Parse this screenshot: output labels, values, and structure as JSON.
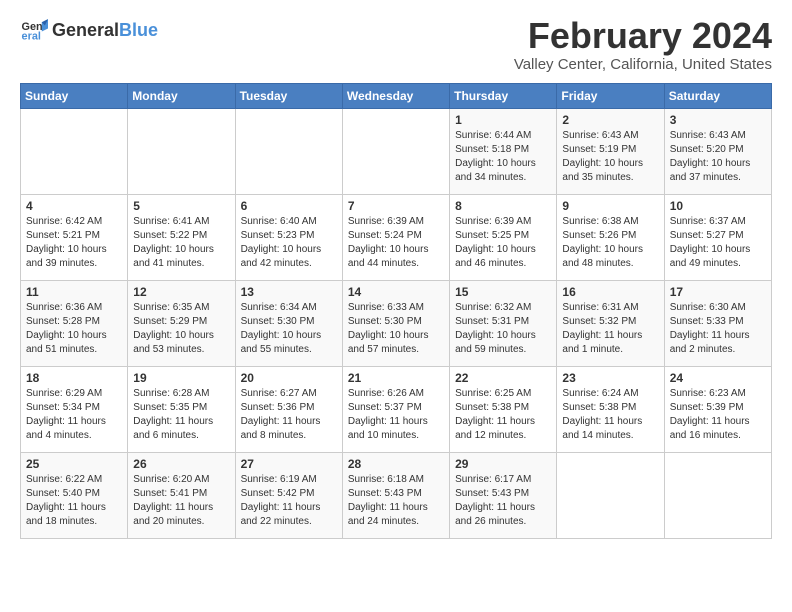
{
  "header": {
    "logo_general": "General",
    "logo_blue": "Blue",
    "month_year": "February 2024",
    "location": "Valley Center, California, United States"
  },
  "weekdays": [
    "Sunday",
    "Monday",
    "Tuesday",
    "Wednesday",
    "Thursday",
    "Friday",
    "Saturday"
  ],
  "weeks": [
    [
      {
        "day": "",
        "sunrise": "",
        "sunset": "",
        "daylight": ""
      },
      {
        "day": "",
        "sunrise": "",
        "sunset": "",
        "daylight": ""
      },
      {
        "day": "",
        "sunrise": "",
        "sunset": "",
        "daylight": ""
      },
      {
        "day": "",
        "sunrise": "",
        "sunset": "",
        "daylight": ""
      },
      {
        "day": "1",
        "sunrise": "Sunrise: 6:44 AM",
        "sunset": "Sunset: 5:18 PM",
        "daylight": "Daylight: 10 hours and 34 minutes."
      },
      {
        "day": "2",
        "sunrise": "Sunrise: 6:43 AM",
        "sunset": "Sunset: 5:19 PM",
        "daylight": "Daylight: 10 hours and 35 minutes."
      },
      {
        "day": "3",
        "sunrise": "Sunrise: 6:43 AM",
        "sunset": "Sunset: 5:20 PM",
        "daylight": "Daylight: 10 hours and 37 minutes."
      }
    ],
    [
      {
        "day": "4",
        "sunrise": "Sunrise: 6:42 AM",
        "sunset": "Sunset: 5:21 PM",
        "daylight": "Daylight: 10 hours and 39 minutes."
      },
      {
        "day": "5",
        "sunrise": "Sunrise: 6:41 AM",
        "sunset": "Sunset: 5:22 PM",
        "daylight": "Daylight: 10 hours and 41 minutes."
      },
      {
        "day": "6",
        "sunrise": "Sunrise: 6:40 AM",
        "sunset": "Sunset: 5:23 PM",
        "daylight": "Daylight: 10 hours and 42 minutes."
      },
      {
        "day": "7",
        "sunrise": "Sunrise: 6:39 AM",
        "sunset": "Sunset: 5:24 PM",
        "daylight": "Daylight: 10 hours and 44 minutes."
      },
      {
        "day": "8",
        "sunrise": "Sunrise: 6:39 AM",
        "sunset": "Sunset: 5:25 PM",
        "daylight": "Daylight: 10 hours and 46 minutes."
      },
      {
        "day": "9",
        "sunrise": "Sunrise: 6:38 AM",
        "sunset": "Sunset: 5:26 PM",
        "daylight": "Daylight: 10 hours and 48 minutes."
      },
      {
        "day": "10",
        "sunrise": "Sunrise: 6:37 AM",
        "sunset": "Sunset: 5:27 PM",
        "daylight": "Daylight: 10 hours and 49 minutes."
      }
    ],
    [
      {
        "day": "11",
        "sunrise": "Sunrise: 6:36 AM",
        "sunset": "Sunset: 5:28 PM",
        "daylight": "Daylight: 10 hours and 51 minutes."
      },
      {
        "day": "12",
        "sunrise": "Sunrise: 6:35 AM",
        "sunset": "Sunset: 5:29 PM",
        "daylight": "Daylight: 10 hours and 53 minutes."
      },
      {
        "day": "13",
        "sunrise": "Sunrise: 6:34 AM",
        "sunset": "Sunset: 5:30 PM",
        "daylight": "Daylight: 10 hours and 55 minutes."
      },
      {
        "day": "14",
        "sunrise": "Sunrise: 6:33 AM",
        "sunset": "Sunset: 5:30 PM",
        "daylight": "Daylight: 10 hours and 57 minutes."
      },
      {
        "day": "15",
        "sunrise": "Sunrise: 6:32 AM",
        "sunset": "Sunset: 5:31 PM",
        "daylight": "Daylight: 10 hours and 59 minutes."
      },
      {
        "day": "16",
        "sunrise": "Sunrise: 6:31 AM",
        "sunset": "Sunset: 5:32 PM",
        "daylight": "Daylight: 11 hours and 1 minute."
      },
      {
        "day": "17",
        "sunrise": "Sunrise: 6:30 AM",
        "sunset": "Sunset: 5:33 PM",
        "daylight": "Daylight: 11 hours and 2 minutes."
      }
    ],
    [
      {
        "day": "18",
        "sunrise": "Sunrise: 6:29 AM",
        "sunset": "Sunset: 5:34 PM",
        "daylight": "Daylight: 11 hours and 4 minutes."
      },
      {
        "day": "19",
        "sunrise": "Sunrise: 6:28 AM",
        "sunset": "Sunset: 5:35 PM",
        "daylight": "Daylight: 11 hours and 6 minutes."
      },
      {
        "day": "20",
        "sunrise": "Sunrise: 6:27 AM",
        "sunset": "Sunset: 5:36 PM",
        "daylight": "Daylight: 11 hours and 8 minutes."
      },
      {
        "day": "21",
        "sunrise": "Sunrise: 6:26 AM",
        "sunset": "Sunset: 5:37 PM",
        "daylight": "Daylight: 11 hours and 10 minutes."
      },
      {
        "day": "22",
        "sunrise": "Sunrise: 6:25 AM",
        "sunset": "Sunset: 5:38 PM",
        "daylight": "Daylight: 11 hours and 12 minutes."
      },
      {
        "day": "23",
        "sunrise": "Sunrise: 6:24 AM",
        "sunset": "Sunset: 5:38 PM",
        "daylight": "Daylight: 11 hours and 14 minutes."
      },
      {
        "day": "24",
        "sunrise": "Sunrise: 6:23 AM",
        "sunset": "Sunset: 5:39 PM",
        "daylight": "Daylight: 11 hours and 16 minutes."
      }
    ],
    [
      {
        "day": "25",
        "sunrise": "Sunrise: 6:22 AM",
        "sunset": "Sunset: 5:40 PM",
        "daylight": "Daylight: 11 hours and 18 minutes."
      },
      {
        "day": "26",
        "sunrise": "Sunrise: 6:20 AM",
        "sunset": "Sunset: 5:41 PM",
        "daylight": "Daylight: 11 hours and 20 minutes."
      },
      {
        "day": "27",
        "sunrise": "Sunrise: 6:19 AM",
        "sunset": "Sunset: 5:42 PM",
        "daylight": "Daylight: 11 hours and 22 minutes."
      },
      {
        "day": "28",
        "sunrise": "Sunrise: 6:18 AM",
        "sunset": "Sunset: 5:43 PM",
        "daylight": "Daylight: 11 hours and 24 minutes."
      },
      {
        "day": "29",
        "sunrise": "Sunrise: 6:17 AM",
        "sunset": "Sunset: 5:43 PM",
        "daylight": "Daylight: 11 hours and 26 minutes."
      },
      {
        "day": "",
        "sunrise": "",
        "sunset": "",
        "daylight": ""
      },
      {
        "day": "",
        "sunrise": "",
        "sunset": "",
        "daylight": ""
      }
    ]
  ]
}
